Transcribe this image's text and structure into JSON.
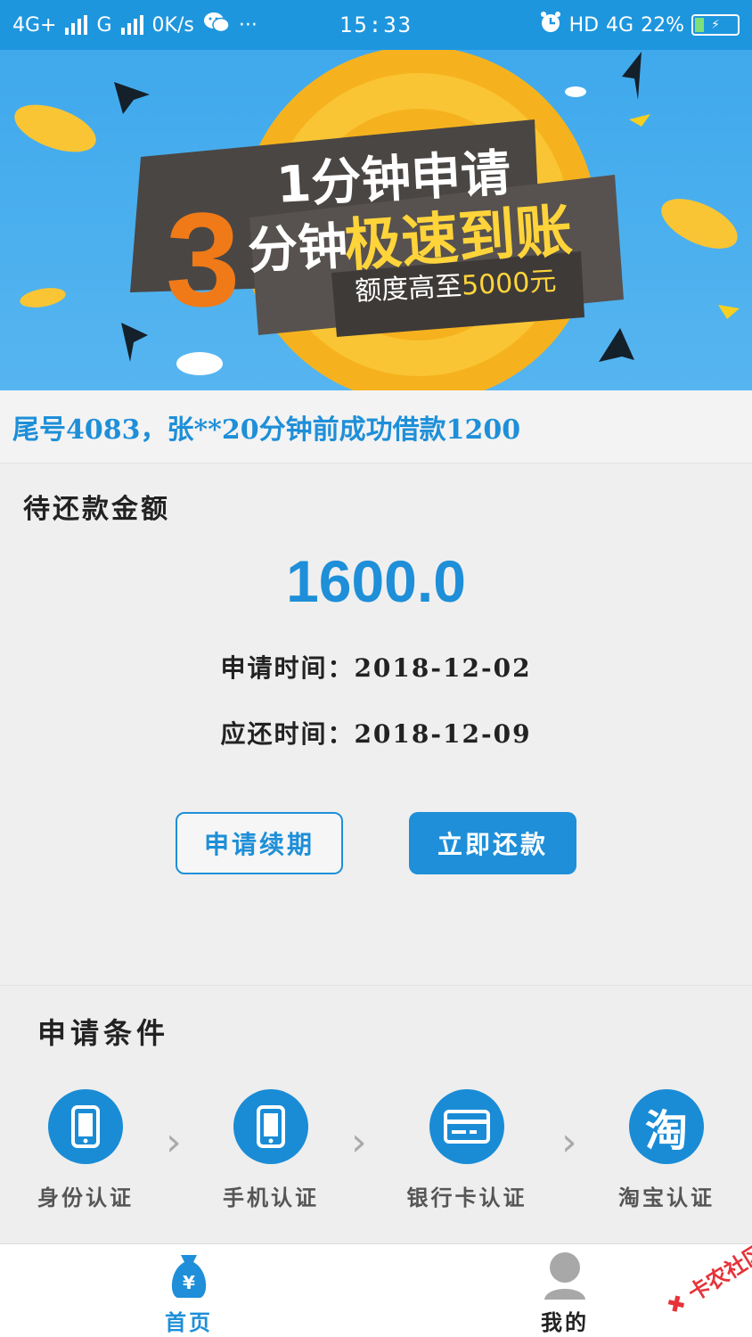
{
  "status_bar": {
    "network1": "4G+",
    "network2": "G",
    "speed": "0K/s",
    "more": "···",
    "time": "15:33",
    "hd": "HD",
    "network3": "4G",
    "battery_pct": "22%",
    "battery_level": 0.22
  },
  "banner": {
    "big_number": "3",
    "line1": "1分钟申请",
    "line2_prefix": "分钟",
    "line2_highlight": "极速到账",
    "line3_prefix": "额度高至",
    "line3_highlight": "5000元"
  },
  "ticker": {
    "text": "尾号4083，张**20分钟前成功借款1200"
  },
  "repayment": {
    "title": "待还款金额",
    "amount": "1600.0",
    "apply_date_label": "申请时间：",
    "apply_date": "2018-12-02",
    "due_date_label": "应还时间：",
    "due_date": "2018-12-09",
    "renew_button": "申请续期",
    "repay_button": "立即还款"
  },
  "conditions": {
    "title": "申请条件",
    "steps": [
      {
        "label": "身份认证",
        "icon": "phone-icon"
      },
      {
        "label": "手机认证",
        "icon": "phone-icon"
      },
      {
        "label": "银行卡认证",
        "icon": "card-icon"
      },
      {
        "label": "淘宝认证",
        "icon": "taobao-icon",
        "glyph": "淘"
      }
    ],
    "chevron": "›"
  },
  "nav": {
    "home_label": "首页",
    "home_icon_glyph": "¥",
    "me_label": "我的"
  },
  "watermark": {
    "text": "卡农社区"
  },
  "colors": {
    "primary": "#1e8fd8",
    "status_bar": "#1e96de",
    "banner_bg": "#3fa9ec",
    "accent_orange": "#f07a18",
    "accent_yellow": "#ffd43a"
  }
}
